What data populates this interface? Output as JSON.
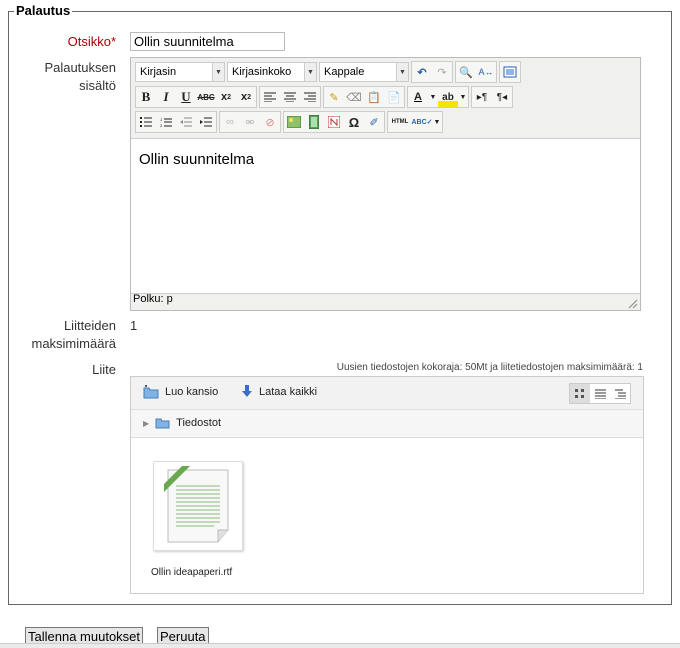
{
  "section": {
    "legend": "Palautus"
  },
  "form": {
    "subject_label": "Otsikko",
    "required_mark": "*",
    "subject_value": "Ollin suunnitelma",
    "content_label": "Palautuksen sisältö",
    "attachments_max_label": "Liitteiden maksimimäärä",
    "attachments_max_value": "1",
    "attachment_label": "Liite"
  },
  "editor": {
    "font_select": "Kirjasin",
    "size_select": "Kirjasinkoko",
    "format_select": "Kappale",
    "content": "Ollin suunnitelma",
    "path_label": "Polku: p"
  },
  "filepicker": {
    "limits_note": "Uusien tiedostojen kokoraja: 50Mt ja liitetiedostojen maksimimäärä: 1",
    "create_folder": "Luo kansio",
    "download_all": "Lataa kaikki",
    "path_root": "Tiedostot",
    "file_name": "Ollin ideapaperi.rtf"
  },
  "buttons": {
    "save": "Tallenna muutokset",
    "cancel": "Peruuta"
  },
  "colors": {
    "required": "#aa0000",
    "folder": "#7fb2e5",
    "file_green": "#6aa84f"
  }
}
